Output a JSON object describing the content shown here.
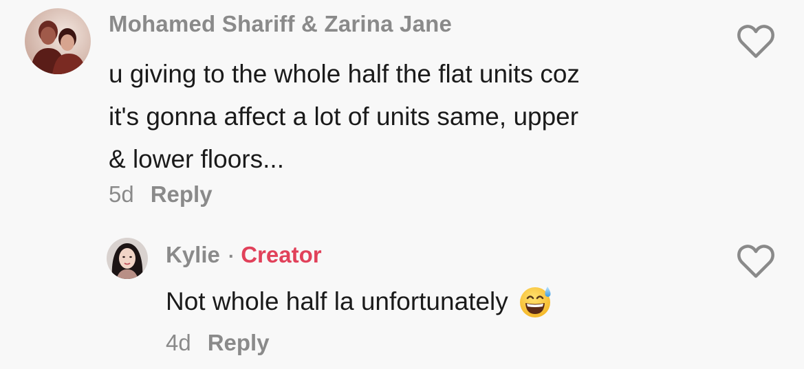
{
  "comment": {
    "author": "Mohamed Shariff & Zarina Jane",
    "text_lines": [
      "u giving to the whole half the flat units coz",
      "it's gonna affect a lot of units same, upper",
      "& lower floors..."
    ],
    "timestamp": "5d",
    "reply_label": "Reply",
    "avatar_icon": "couple-photo-avatar",
    "like_icon": "heart-outline-icon"
  },
  "reply": {
    "author": "Kylie",
    "separator": "·",
    "badge": "Creator",
    "text": "Not whole half la unfortunately",
    "emoji_icon": "grinning-face-with-sweat-emoji",
    "timestamp": "4d",
    "reply_label": "Reply",
    "avatar_icon": "woman-photo-avatar",
    "like_icon": "heart-outline-icon"
  },
  "colors": {
    "background": "#f8f8f8",
    "text": "#1a1a1a",
    "muted": "#8a8a8a",
    "creator": "#e1415a"
  }
}
